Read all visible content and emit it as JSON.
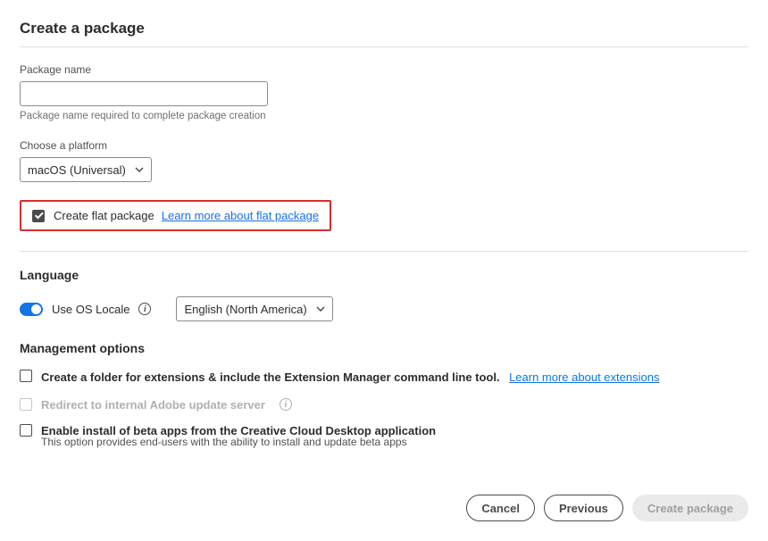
{
  "title": "Create a package",
  "package_name": {
    "label": "Package name",
    "value": "",
    "helper": "Package name required to complete package creation"
  },
  "platform": {
    "label": "Choose a platform",
    "selected": "macOS (Universal)"
  },
  "flat_package": {
    "label": "Create flat package",
    "link": "Learn more about flat package"
  },
  "language": {
    "heading": "Language",
    "toggle_label": "Use OS Locale",
    "selected": "English (North America)"
  },
  "management": {
    "heading": "Management options",
    "opt1": {
      "label": "Create a folder for extensions & include the Extension Manager command line tool.",
      "link": "Learn more about extensions"
    },
    "opt2": {
      "label": "Redirect to internal Adobe update server"
    },
    "opt3": {
      "label": "Enable install of beta apps from the Creative Cloud Desktop application",
      "helper": "This option provides end-users with the ability to install and update beta apps"
    }
  },
  "footer": {
    "cancel": "Cancel",
    "previous": "Previous",
    "create": "Create package"
  }
}
